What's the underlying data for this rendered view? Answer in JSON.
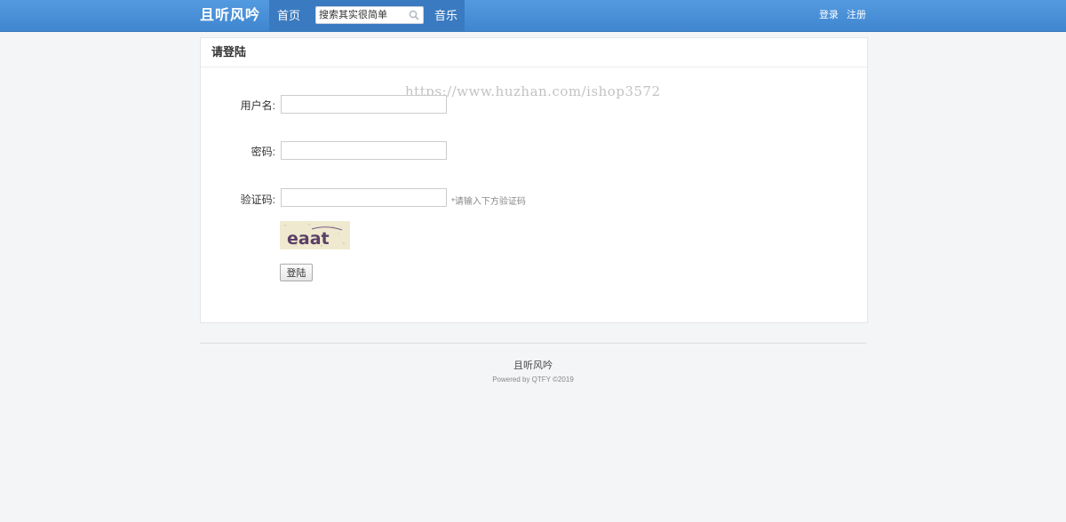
{
  "nav": {
    "brand": "且听风吟",
    "home": "首页",
    "search_placeholder": "搜索其实很简单",
    "music": "音乐",
    "login": "登录",
    "register": "注册"
  },
  "login_panel": {
    "title": "请登陆",
    "watermark": "https://www.huzhan.com/ishop3572",
    "username_label": "用户名:",
    "password_label": "密码:",
    "captcha_label": "验证码:",
    "captcha_hint": "*请输入下方验证码",
    "captcha_text": "eaat",
    "submit": "登陆"
  },
  "footer": {
    "title": "且听风吟",
    "powered": "Powered by QTFY ©2019"
  },
  "colors": {
    "navbar": "#4a90d9",
    "nav_active": "#3a7ac0",
    "background": "#f4f5f7"
  }
}
